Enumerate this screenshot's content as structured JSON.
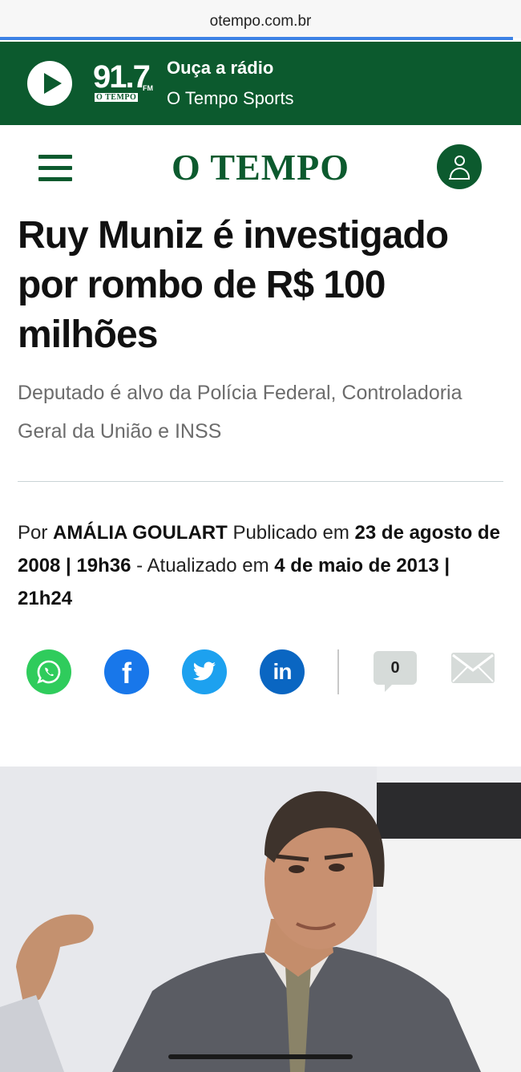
{
  "browser": {
    "url": "otempo.com.br"
  },
  "radio_banner": {
    "frequency": "91.7",
    "frequency_unit": "FM",
    "brand_tag": "O TEMPO",
    "line1": "Ouça a rádio",
    "line2": "O Tempo Sports",
    "background_color": "#0c5a2e"
  },
  "header": {
    "logo": "O TEMPO",
    "menu_icon": "hamburger-icon",
    "account_icon": "user-icon"
  },
  "article": {
    "title": "Ruy Muniz é investigado por rombo de R$ 100 milhões",
    "subtitle": "Deputado é alvo da Polícia Federal, Controladoria Geral da União e INSS",
    "byline": {
      "by_label": "Por",
      "author": "AMÁLIA GOULART",
      "published_label": "Publicado em",
      "published": "23 de agosto de 2008 | 19h36",
      "separator": "-",
      "updated_label": "Atualizado em",
      "updated": "4 de maio de 2013 | 21h24"
    }
  },
  "share": {
    "whatsapp_icon": "whatsapp-icon",
    "facebook_icon": "facebook-icon",
    "facebook_glyph": "f",
    "twitter_icon": "twitter-icon",
    "linkedin_icon": "linkedin-icon",
    "linkedin_glyph": "in",
    "comment_count": "0",
    "email_icon": "envelope-icon"
  },
  "colors": {
    "brand_green": "#0c5a2e",
    "whatsapp": "#2fcc5c",
    "facebook": "#1877ea",
    "twitter": "#1da1ef",
    "linkedin": "#0a66c2"
  }
}
